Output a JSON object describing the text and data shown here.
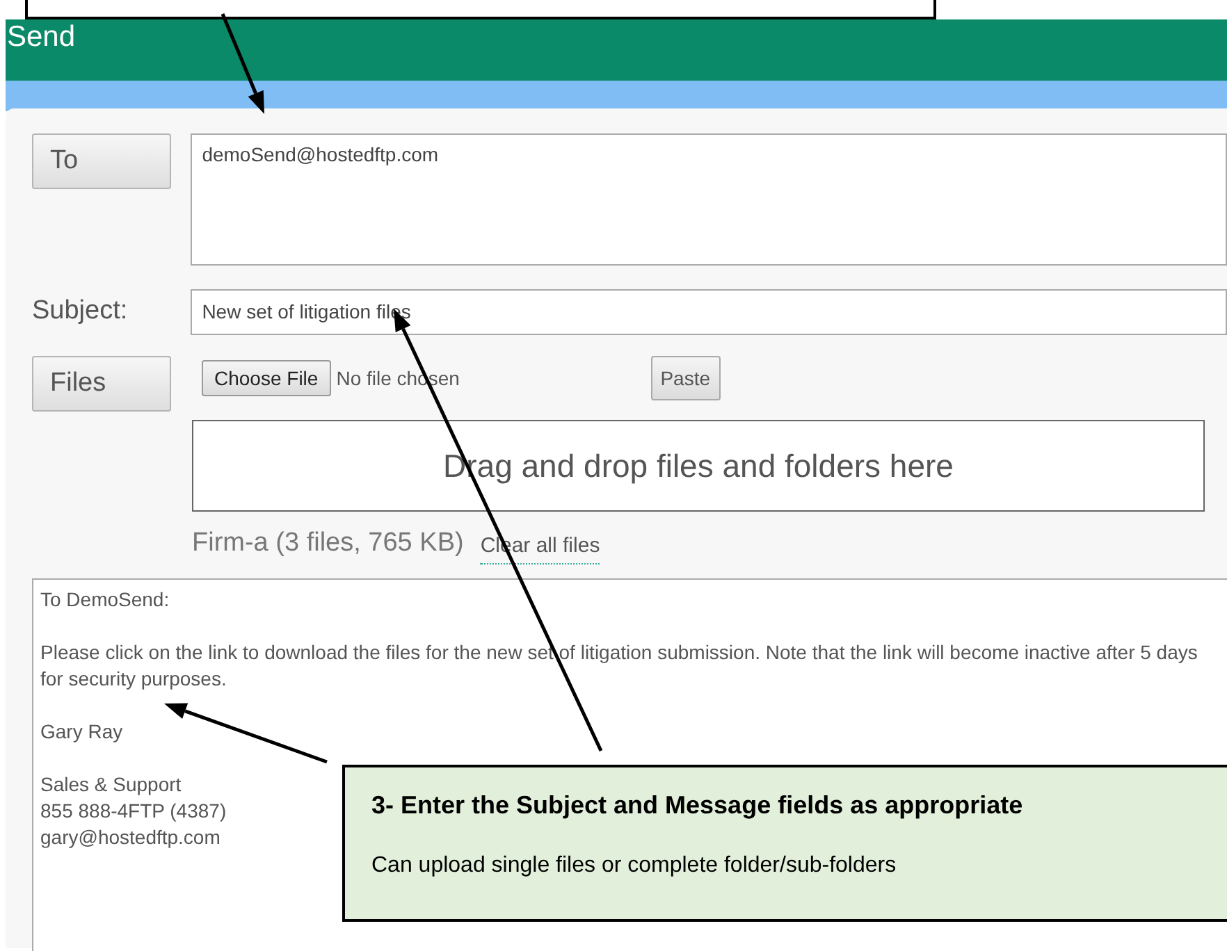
{
  "header": {
    "title": "Send"
  },
  "to": {
    "button": "To",
    "value": "demoSend@hostedftp.com"
  },
  "subject": {
    "label": "Subject:",
    "value": "New set of litigation files"
  },
  "files": {
    "button": "Files",
    "choose": "Choose File",
    "status": "No file chosen",
    "paste": "Paste",
    "dropzone": "Drag and drop files and folders here",
    "summary": "Firm-a (3 files, 765 KB)",
    "clear_link": "Clear all files"
  },
  "message": {
    "value": "To DemoSend:\n\nPlease click on the link to download the files for the new set of litigation submission. Note that the link will become inactive after 5 days for security purposes.\n\nGary Ray\n\nSales & Support\n855 888-4FTP (4387)\ngary@hostedftp.com"
  },
  "callout": {
    "title": "3- Enter the Subject and Message fields as appropriate",
    "text": "Can upload single files or complete folder/sub-folders"
  }
}
